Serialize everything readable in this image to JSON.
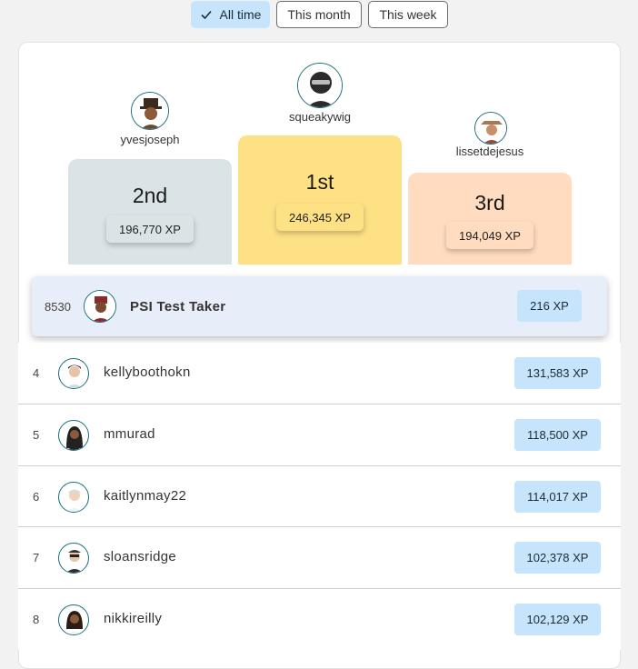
{
  "filters": [
    {
      "label": "All time",
      "active": true
    },
    {
      "label": "This month",
      "active": false
    },
    {
      "label": "This week",
      "active": false
    }
  ],
  "podium": {
    "first": {
      "rank": "1st",
      "name": "squeakywig",
      "xp": "246,345 XP",
      "color": "#fee085"
    },
    "second": {
      "rank": "2nd",
      "name": "yvesjoseph",
      "xp": "196,770 XP",
      "color": "#dae4e7"
    },
    "third": {
      "rank": "3rd",
      "name": "lissetdejesus",
      "xp": "194,049 XP",
      "color": "#ffdcc0"
    }
  },
  "current_user": {
    "rank": "8530",
    "name": "PSI Test Taker",
    "xp": "216 XP"
  },
  "leaderboard": [
    {
      "rank": "4",
      "name": "kellyboothokn",
      "xp": "131,583 XP"
    },
    {
      "rank": "5",
      "name": "mmurad",
      "xp": "118,500 XP"
    },
    {
      "rank": "6",
      "name": "kaitlynmay22",
      "xp": "114,017 XP"
    },
    {
      "rank": "7",
      "name": "sloansridge",
      "xp": "102,378 XP"
    },
    {
      "rank": "8",
      "name": "nikkireilly",
      "xp": "102,129 XP"
    }
  ],
  "colors": {
    "accent": "#c6e4fb",
    "highlight_row": "#e8eef9",
    "avatar_ring": "#1a6f7a"
  },
  "icons": [
    "check-icon",
    "avatar-icon"
  ]
}
